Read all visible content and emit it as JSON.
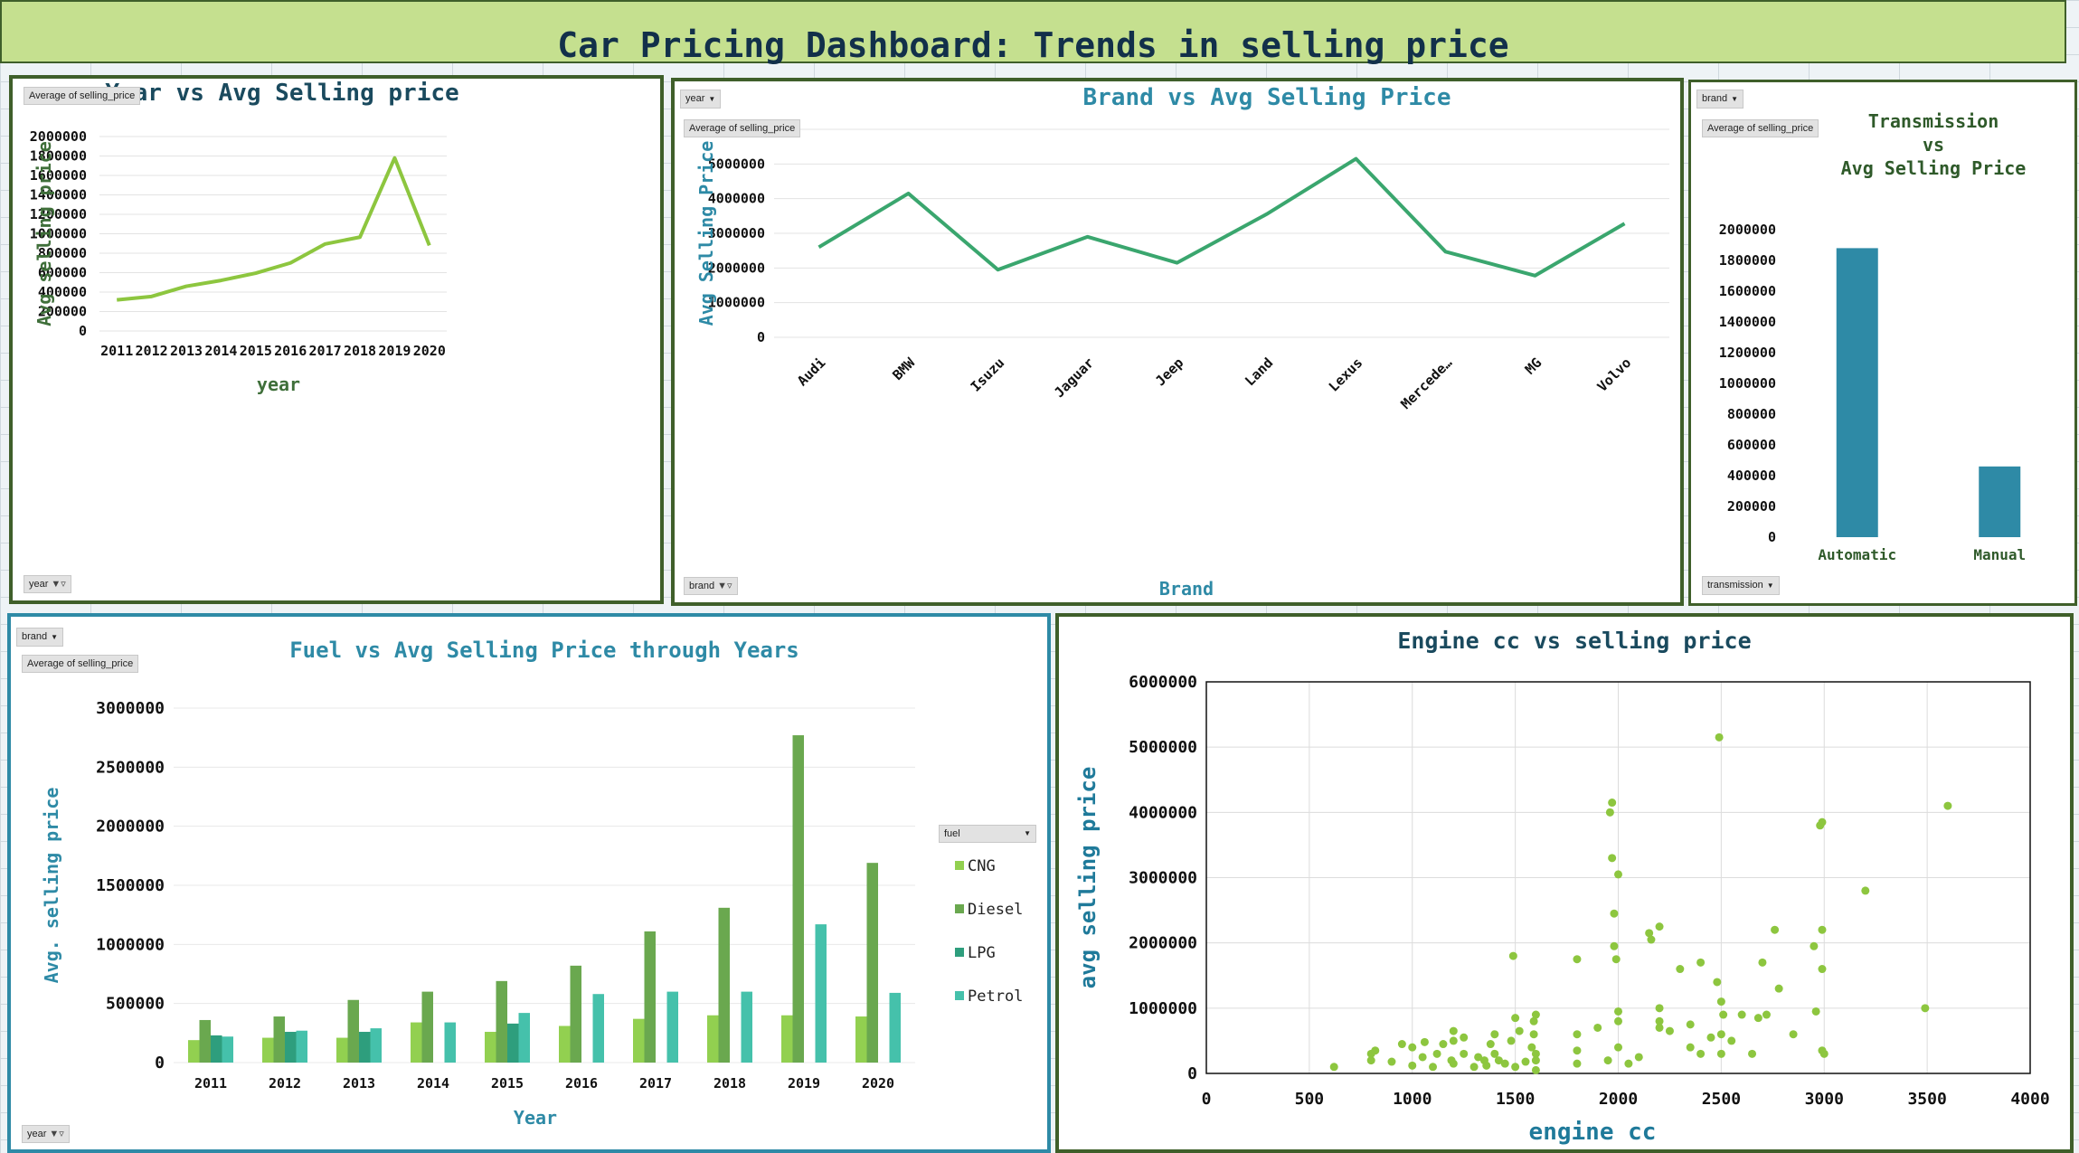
{
  "dashboard": {
    "title": "Car Pricing Dashboard: Trends in selling price"
  },
  "colors": {
    "panel_border_green": "#3f5f2a",
    "panel_border_teal": "#2e8aa6",
    "lime": "#8dc63f",
    "green": "#3aa66e",
    "teal_bar": "#2e8aa6",
    "title_teal": "#2e8aa6",
    "title_navy": "#1a4a5e"
  },
  "panels": {
    "year": {
      "field_button": "Average of selling_price",
      "filter_button": "year"
    },
    "brand": {
      "top_filter": "year",
      "field_button": "Average of selling_price",
      "axis_button": "brand"
    },
    "transmission": {
      "top_filter": "brand",
      "field_button": "Average of selling_price",
      "axis_button": "transmission"
    },
    "fuel": {
      "top_filter": "brand",
      "field_button": "Average of selling_price",
      "legend_field": "fuel",
      "axis_button": "year"
    }
  },
  "chart_data": [
    {
      "id": "year_line",
      "type": "line",
      "title": "Year vs Avg Selling price",
      "xlabel": "year",
      "ylabel": "Avg selling price",
      "categories": [
        "2011",
        "2012",
        "2013",
        "2014",
        "2015",
        "2016",
        "2017",
        "2018",
        "2019",
        "2020"
      ],
      "series": [
        {
          "values": [
            320000,
            355000,
            460000,
            520000,
            595000,
            700000,
            895000,
            965000,
            1780000,
            880000
          ]
        }
      ],
      "ylim": [
        0,
        2000000
      ],
      "yticks": [
        0,
        200000,
        400000,
        600000,
        800000,
        1000000,
        1200000,
        1400000,
        1600000,
        1800000,
        2000000
      ],
      "grid": true
    },
    {
      "id": "brand_line",
      "type": "line",
      "title": "Brand vs Avg Selling Price",
      "xlabel": "Brand",
      "ylabel": "Avg Selling Price",
      "categories": [
        "Audi",
        "BMW",
        "Isuzu",
        "Jaguar",
        "Jeep",
        "Land",
        "Lexus",
        "Mercede…",
        "MG",
        "Volvo"
      ],
      "series": [
        {
          "values": [
            2600000,
            4150000,
            1950000,
            2900000,
            2150000,
            3550000,
            5150000,
            2470000,
            1780000,
            3280000
          ]
        }
      ],
      "ylim": [
        0,
        6000000
      ],
      "yticks": [
        0,
        1000000,
        2000000,
        3000000,
        4000000,
        5000000,
        6000000
      ],
      "grid": true
    },
    {
      "id": "transmission_bar",
      "type": "bar",
      "title": "Transmission vs Avg Selling Price",
      "title_lines": [
        "Transmission",
        "vs",
        "Avg Selling Price"
      ],
      "categories": [
        "Automatic",
        "Manual"
      ],
      "values": [
        1880000,
        460000
      ],
      "ylim": [
        0,
        2000000
      ],
      "yticks": [
        0,
        200000,
        400000,
        600000,
        800000,
        1000000,
        1200000,
        1400000,
        1600000,
        1800000,
        2000000
      ]
    },
    {
      "id": "fuel_bar",
      "type": "bar",
      "title": "Fuel vs Avg Selling Price through Years",
      "xlabel": "Year",
      "ylabel": "Avg. selling price",
      "categories": [
        "2011",
        "2012",
        "2013",
        "2014",
        "2015",
        "2016",
        "2017",
        "2018",
        "2019",
        "2020"
      ],
      "series": [
        {
          "name": "CNG",
          "color": "#92d050",
          "values": [
            190000,
            210000,
            210000,
            340000,
            260000,
            310000,
            370000,
            400000,
            400000,
            390000
          ]
        },
        {
          "name": "Diesel",
          "color": "#6aa84f",
          "values": [
            360000,
            390000,
            530000,
            600000,
            690000,
            820000,
            1110000,
            1310000,
            2770000,
            1690000
          ]
        },
        {
          "name": "LPG",
          "color": "#2e9e7d",
          "values": [
            230000,
            260000,
            260000,
            null,
            330000,
            null,
            null,
            null,
            null,
            null
          ]
        },
        {
          "name": "Petrol",
          "color": "#45c1ab",
          "values": [
            220000,
            270000,
            290000,
            340000,
            420000,
            580000,
            600000,
            600000,
            1170000,
            590000
          ]
        }
      ],
      "ylim": [
        0,
        3000000
      ],
      "yticks": [
        0,
        500000,
        1000000,
        1500000,
        2000000,
        2500000,
        3000000
      ],
      "grid": true,
      "legend": "right"
    },
    {
      "id": "engine_scatter",
      "type": "scatter",
      "title": "Engine cc vs selling price",
      "xlabel": "engine cc",
      "ylabel": "avg selling price",
      "xlim": [
        0,
        4000
      ],
      "ylim": [
        0,
        6000000
      ],
      "xticks": [
        0,
        500,
        1000,
        1500,
        2000,
        2500,
        3000,
        3500,
        4000
      ],
      "yticks": [
        0,
        1000000,
        2000000,
        3000000,
        4000000,
        5000000,
        6000000
      ],
      "grid": true,
      "points": [
        [
          620,
          100000
        ],
        [
          800,
          300000
        ],
        [
          800,
          200000
        ],
        [
          820,
          350000
        ],
        [
          900,
          180000
        ],
        [
          950,
          450000
        ],
        [
          1000,
          120000
        ],
        [
          1000,
          400000
        ],
        [
          1050,
          250000
        ],
        [
          1060,
          480000
        ],
        [
          1100,
          100000
        ],
        [
          1120,
          300000
        ],
        [
          1150,
          450000
        ],
        [
          1190,
          200000
        ],
        [
          1200,
          650000
        ],
        [
          1200,
          500000
        ],
        [
          1200,
          150000
        ],
        [
          1250,
          300000
        ],
        [
          1250,
          550000
        ],
        [
          1300,
          100000
        ],
        [
          1320,
          250000
        ],
        [
          1350,
          200000
        ],
        [
          1360,
          120000
        ],
        [
          1380,
          450000
        ],
        [
          1400,
          600000
        ],
        [
          1400,
          300000
        ],
        [
          1420,
          200000
        ],
        [
          1450,
          150000
        ],
        [
          1480,
          500000
        ],
        [
          1490,
          1800000
        ],
        [
          1500,
          850000
        ],
        [
          1500,
          100000
        ],
        [
          1520,
          650000
        ],
        [
          1550,
          180000
        ],
        [
          1580,
          400000
        ],
        [
          1590,
          600000
        ],
        [
          1590,
          800000
        ],
        [
          1600,
          900000
        ],
        [
          1600,
          50000
        ],
        [
          1600,
          200000
        ],
        [
          1600,
          300000
        ],
        [
          1800,
          1750000
        ],
        [
          1800,
          600000
        ],
        [
          1800,
          350000
        ],
        [
          1800,
          150000
        ],
        [
          1900,
          700000
        ],
        [
          1950,
          200000
        ],
        [
          1960,
          4000000
        ],
        [
          1970,
          4150000
        ],
        [
          1970,
          3300000
        ],
        [
          1980,
          2450000
        ],
        [
          1980,
          1950000
        ],
        [
          1990,
          1750000
        ],
        [
          2000,
          3050000
        ],
        [
          2000,
          950000
        ],
        [
          2000,
          400000
        ],
        [
          2000,
          800000
        ],
        [
          2050,
          150000
        ],
        [
          2100,
          250000
        ],
        [
          2150,
          2150000
        ],
        [
          2160,
          2050000
        ],
        [
          2200,
          2250000
        ],
        [
          2200,
          1000000
        ],
        [
          2200,
          800000
        ],
        [
          2200,
          700000
        ],
        [
          2250,
          650000
        ],
        [
          2300,
          1600000
        ],
        [
          2350,
          750000
        ],
        [
          2350,
          400000
        ],
        [
          2400,
          1700000
        ],
        [
          2400,
          300000
        ],
        [
          2450,
          550000
        ],
        [
          2480,
          1400000
        ],
        [
          2490,
          5150000
        ],
        [
          2500,
          1100000
        ],
        [
          2500,
          600000
        ],
        [
          2500,
          300000
        ],
        [
          2510,
          900000
        ],
        [
          2550,
          500000
        ],
        [
          2600,
          900000
        ],
        [
          2650,
          300000
        ],
        [
          2680,
          850000
        ],
        [
          2700,
          1700000
        ],
        [
          2720,
          900000
        ],
        [
          2760,
          2200000
        ],
        [
          2780,
          1300000
        ],
        [
          2850,
          600000
        ],
        [
          2950,
          1950000
        ],
        [
          2960,
          950000
        ],
        [
          2980,
          3800000
        ],
        [
          2990,
          3850000
        ],
        [
          2990,
          2200000
        ],
        [
          2990,
          1600000
        ],
        [
          2990,
          350000
        ],
        [
          3000,
          300000
        ],
        [
          3200,
          2800000
        ],
        [
          3490,
          1000000
        ],
        [
          3600,
          4100000
        ]
      ]
    }
  ]
}
